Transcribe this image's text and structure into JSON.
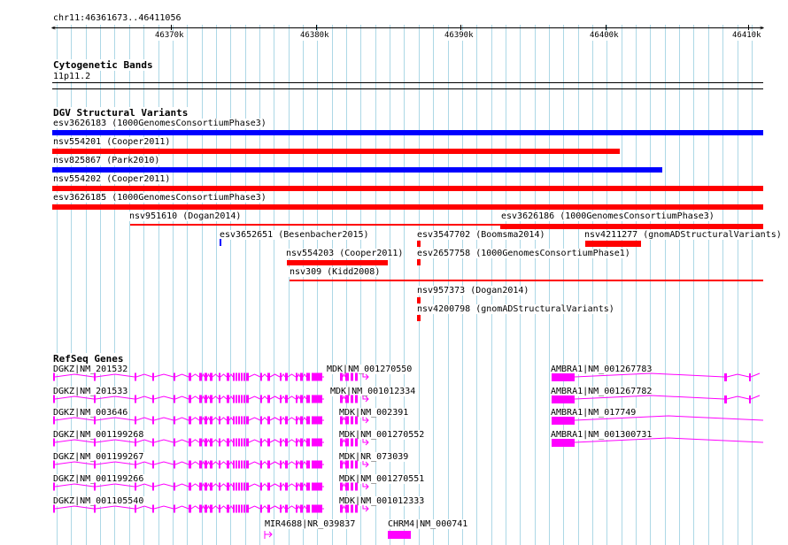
{
  "location": "chr11:46361673..46411056",
  "ruler": {
    "start": 46361673,
    "end": 46411056,
    "ticks": [
      "46370k",
      "46380k",
      "46390k",
      "46400k",
      "46410k"
    ]
  },
  "tracks": {
    "cyto": {
      "title": "Cytogenetic Bands",
      "band": "11p11.2"
    },
    "dgv": {
      "title": "DGV Structural Variants",
      "features": [
        {
          "label": "esv3626183 (1000GenomesConsortiumPhase3)",
          "color": "#0000ff"
        },
        {
          "label": "nsv554201 (Cooper2011)",
          "color": "#ff0000"
        },
        {
          "label": "nsv825867 (Park2010)",
          "color": "#0000ff"
        },
        {
          "label": "nsv554202 (Cooper2011)",
          "color": "#ff0000"
        },
        {
          "label": "esv3626185 (1000GenomesConsortiumPhase3)",
          "color": "#ff0000"
        },
        {
          "label": "nsv951610 (Dogan2014)",
          "color": "#ff0000"
        },
        {
          "label": "esv3626186 (1000GenomesConsortiumPhase3)",
          "color": "#ff0000"
        },
        {
          "label": "esv3652651 (Besenbacher2015)",
          "color": "#0000ff"
        },
        {
          "label": "esv3547702 (Boomsma2014)",
          "color": "#ff0000"
        },
        {
          "label": "nsv4211277 (gnomADStructuralVariants)",
          "color": "#ff0000"
        },
        {
          "label": "nsv554203 (Cooper2011)",
          "color": "#ff0000"
        },
        {
          "label": "esv2657758 (1000GenomesConsortiumPhase1)",
          "color": "#ff0000"
        },
        {
          "label": "nsv309 (Kidd2008)",
          "color": "#ff0000"
        },
        {
          "label": "nsv957373 (Dogan2014)",
          "color": "#ff0000"
        },
        {
          "label": "nsv4200798 (gnomADStructuralVariants)",
          "color": "#ff0000"
        }
      ]
    },
    "refseq": {
      "title": "RefSeq Genes",
      "color": "#ff00ff",
      "genes": [
        "DGKZ|NM_201532",
        "DGKZ|NM_201533",
        "DGKZ|NM_003646",
        "DGKZ|NM_001199268",
        "DGKZ|NM_001199267",
        "DGKZ|NM_001199266",
        "DGKZ|NM_001105540",
        "MDK|NM_001270550",
        "MDK|NM_001012334",
        "MDK|NM_002391",
        "MDK|NM_001270552",
        "MDK|NR_073039",
        "MDK|NM_001270551",
        "MDK|NM_001012333",
        "AMBRA1|NM_001267783",
        "AMBRA1|NM_001267782",
        "AMBRA1|NM_017749",
        "AMBRA1|NM_001300731",
        "MIR4688|NR_039837",
        "CHRM4|NM_000741"
      ]
    }
  }
}
